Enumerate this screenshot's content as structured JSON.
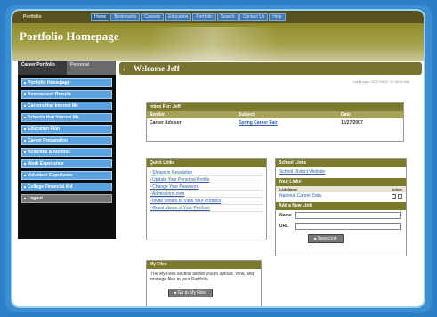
{
  "header": {
    "brand": "Portfolio",
    "title": "Portfolio Homepage",
    "nav": [
      "Home",
      "Bookmarks",
      "Careers",
      "Education",
      "Portfolio",
      "Search",
      "Contact Us",
      "Help"
    ]
  },
  "sidebar": {
    "tabs": [
      "Career Portfolio",
      "Personal"
    ],
    "items": [
      "Portfolio Homepage",
      "Assessment Results",
      "Careers that Interest Me",
      "Schools that Interest Me",
      "Education Plan",
      "Career Preparation",
      "Activities & Abilities",
      "Work Experience",
      "Volunteer Experience",
      "College Financial Aid",
      "Logout"
    ]
  },
  "welcome": {
    "text": "Welcome Jeff",
    "last_login": "Last Login: 11/27/2007 11:18:04 AM"
  },
  "inbox": {
    "title": "Inbox For: Jeff",
    "columns": [
      "Sender",
      "Subject",
      "Date"
    ],
    "rows": [
      {
        "sender": "Career Advisor",
        "subject": "Spring Career Fair",
        "date": "11/27/2007"
      }
    ]
  },
  "quick_links": {
    "title": "Quick Links",
    "items": [
      "Shows in Newsletter",
      "Update Your Personal Profile",
      "Change Your Password",
      "Admissions.com",
      "Invite Others to View Your Portfolio",
      "Guest Views of Your Portfolio"
    ]
  },
  "school_links": {
    "title": "School Links",
    "school_item": "School District Website",
    "your_links_title": "Your Links",
    "col_name": "Link Name",
    "col_action": "Action",
    "link_name": "National Career Data",
    "add_title": "Add a New Link",
    "name_label": "Name",
    "url_label": "URL",
    "save_label": "Save Link"
  },
  "files": {
    "title": "My Files",
    "description": "The My Files section allows you to upload, view, and manage files in your Portfolio.",
    "button": "Go to My Files"
  }
}
